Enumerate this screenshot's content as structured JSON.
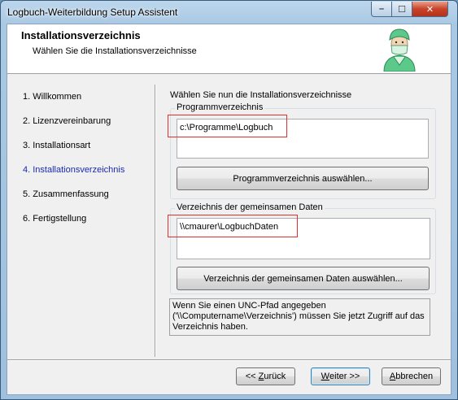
{
  "window": {
    "title": "Logbuch-Weiterbildung Setup Assistent",
    "minimize_glyph": "–",
    "maximize_glyph": "☐",
    "close_glyph": "✕"
  },
  "header": {
    "title": "Installationsverzeichnis",
    "subtitle": "Wählen Sie die Installationsverzeichnisse",
    "icon": "doctor-icon"
  },
  "steps": [
    {
      "label": "1. Willkommen",
      "active": false
    },
    {
      "label": "2. Lizenzvereinbarung",
      "active": false
    },
    {
      "label": "3. Installationsart",
      "active": false
    },
    {
      "label": "4. Installationsverzeichnis",
      "active": true
    },
    {
      "label": "5. Zusammenfassung",
      "active": false
    },
    {
      "label": "6. Fertigstellung",
      "active": false
    }
  ],
  "main": {
    "intro": "Wählen Sie nun die Installationsverzeichnisse",
    "program_group": {
      "label": "Programmverzeichnis",
      "value": "c:\\Programme\\Logbuch",
      "button": "Programmverzeichnis auswählen..."
    },
    "data_group": {
      "label": "Verzeichnis der gemeinsamen Daten",
      "value": "\\\\cmaurer\\LogbuchDaten",
      "button": "Verzeichnis der gemeinsamen Daten auswählen..."
    },
    "note": "Wenn Sie einen UNC-Pfad angegeben ('\\\\Computername\\Verzeichnis') müssen Sie jetzt Zugriff auf das Verzeichnis haben."
  },
  "footer": {
    "back_prefix": "<< ",
    "back_key": "Z",
    "back_rest": "urück",
    "next_key": "W",
    "next_rest": "eiter >>",
    "cancel_key": "A",
    "cancel_rest": "bbrechen"
  },
  "colors": {
    "active_step": "#1a2ab0",
    "highlight": "#e03030"
  }
}
